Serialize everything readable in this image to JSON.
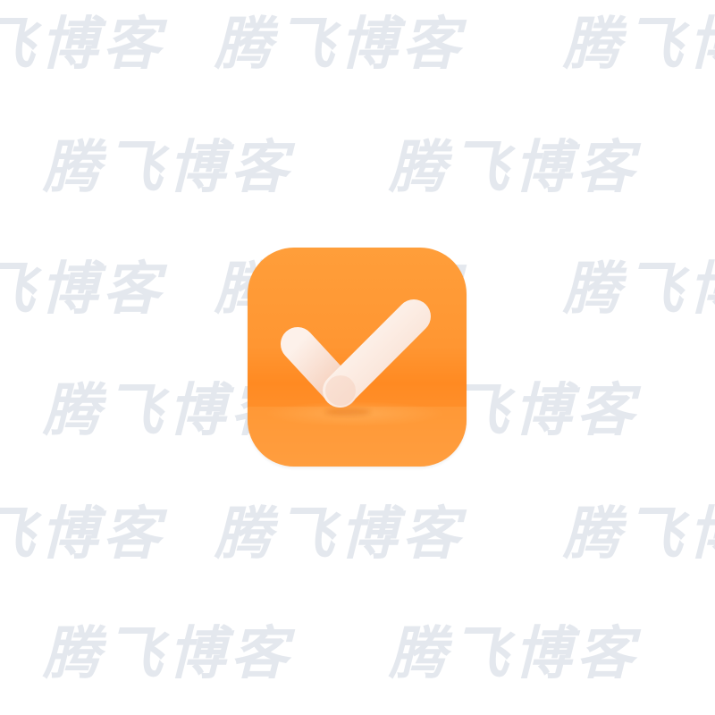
{
  "watermark": {
    "text": "腾飞博客",
    "fragment_left_text": "博客",
    "fragment_right_text": "腾飞",
    "color": "#e4e8ee"
  },
  "app_icon": {
    "icon_name": "checkmark-icon",
    "background_color": "#ff9632",
    "check_color": "#fbe9df"
  }
}
